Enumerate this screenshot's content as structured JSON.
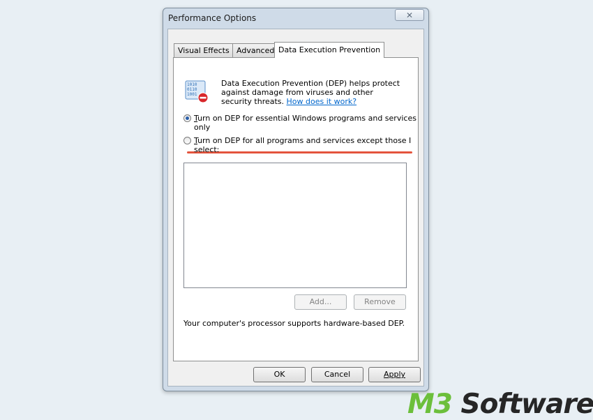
{
  "window": {
    "title": "Performance Options",
    "close_glyph": "✕"
  },
  "tabs": [
    {
      "label": "Visual Effects",
      "active": false
    },
    {
      "label": "Advanced",
      "active": false
    },
    {
      "label": "Data Execution Prevention",
      "active": true
    }
  ],
  "dep": {
    "icon": "dep-shield-icon",
    "description": "Data Execution Prevention (DEP) helps protect against damage from viruses and other security threats.",
    "link": "How does it work?",
    "option1": {
      "label_first": "T",
      "label_rest": "urn on DEP for essential Windows programs and services only",
      "checked": true
    },
    "option2": {
      "label_first": "T",
      "label_rest": "urn on DEP for all programs and services except those I select:",
      "checked": false
    },
    "add_button": "Add...",
    "remove_button": "Remove",
    "support_text": "Your computer's processor supports hardware-based DEP."
  },
  "footer": {
    "ok": "OK",
    "cancel": "Cancel",
    "apply": "Apply"
  },
  "watermark": {
    "part1": "M3",
    "part2": " Software"
  },
  "colors": {
    "highlight_underline": "#e4543d",
    "brand_green": "#6cbf3b"
  }
}
